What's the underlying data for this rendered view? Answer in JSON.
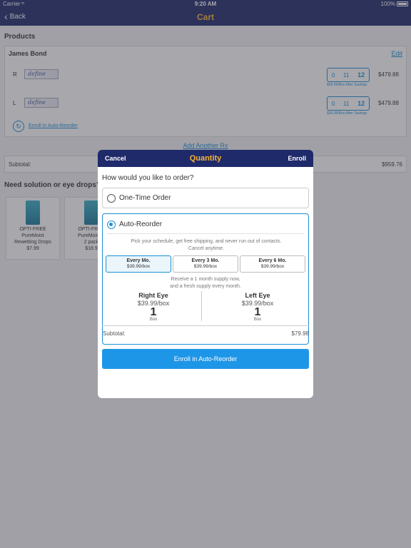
{
  "status_bar": {
    "carrier": "Carrier",
    "time": "9:20 AM",
    "battery": "100%"
  },
  "nav": {
    "back_label": "Back",
    "title": "Cart"
  },
  "products": {
    "section_title": "Products",
    "patient_name": "James Bond",
    "edit_label": "Edit",
    "rows": [
      {
        "eye": "R",
        "brand": "define",
        "stepper": [
          "0",
          "11",
          "12"
        ],
        "selected": "12",
        "note": "$39.99/Box After Savings",
        "price": "$479.88"
      },
      {
        "eye": "L",
        "brand": "define",
        "stepper": [
          "0",
          "11",
          "12"
        ],
        "selected": "12",
        "note": "$39.99/Box After Savings",
        "price": "$479.88"
      }
    ],
    "enroll_link": "Enroll in Auto-Reorder",
    "add_rx": "Add Another Rx",
    "subtotal_label": "Subtotal:",
    "subtotal_value": "$959.76"
  },
  "drops": {
    "title": "Need solution or eye drops?",
    "items": [
      {
        "line1": "OPTI-FREE",
        "line2": "PureMoist",
        "line3": "Rewetting Drops",
        "price": "$7.99"
      },
      {
        "line1": "OPTI-FREE",
        "line2": "PureMoist S",
        "line3": "2 pack",
        "price": "$18.9"
      }
    ]
  },
  "modal": {
    "cancel": "Cancel",
    "title": "Quantity",
    "enroll": "Enroll",
    "question": "How would you like to order?",
    "one_time": "One-Time Order",
    "auto_reorder": "Auto-Reorder",
    "desc_line1": "Pick your schedule, get free shipping, and never run out of contacts.",
    "desc_line2": "Cancel anytime.",
    "frequencies": [
      {
        "name": "Every Mo.",
        "price": "$39.99/box"
      },
      {
        "name": "Every 3 Mo.",
        "price": "$39.99/box"
      },
      {
        "name": "Every 6 Mo.",
        "price": "$39.99/box"
      }
    ],
    "receive_line1": "Receive a 1 month supply now,",
    "receive_line2": "and a fresh supply every month.",
    "right_eye": {
      "name": "Right Eye",
      "price": "$39.99/box",
      "qty": "1",
      "unit": "Box"
    },
    "left_eye": {
      "name": "Left Eye",
      "price": "$39.99/box",
      "qty": "1",
      "unit": "Box"
    },
    "subtotal_label": "Subtotal:",
    "subtotal_value": "$79.98",
    "button": "Enroll in Auto-Reorder"
  },
  "colors": {
    "nav": "#1f2a6b",
    "accent_title": "#f5b335",
    "link": "#1e8fd4",
    "button": "#1e96e8"
  }
}
